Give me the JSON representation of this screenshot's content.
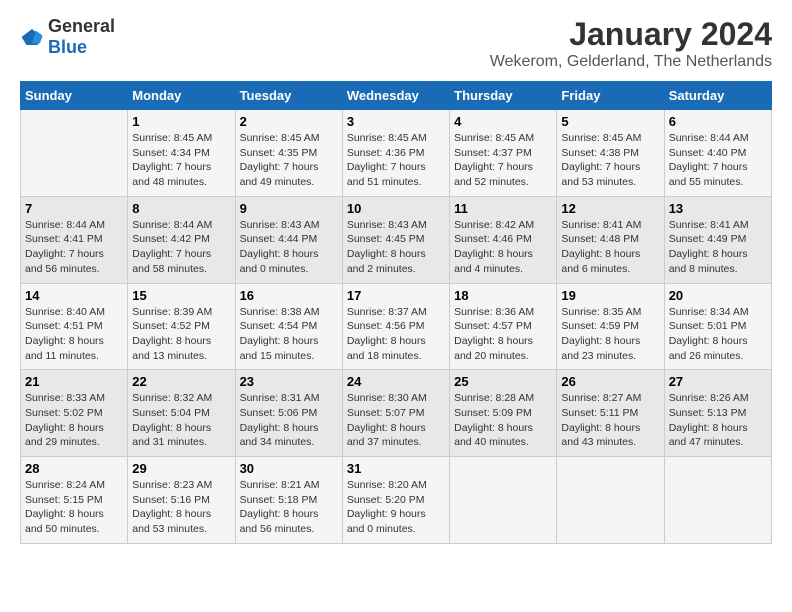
{
  "logo": {
    "general": "General",
    "blue": "Blue"
  },
  "title": "January 2024",
  "subtitle": "Wekerom, Gelderland, The Netherlands",
  "days_of_week": [
    "Sunday",
    "Monday",
    "Tuesday",
    "Wednesday",
    "Thursday",
    "Friday",
    "Saturday"
  ],
  "weeks": [
    [
      {
        "day": "",
        "content": ""
      },
      {
        "day": "1",
        "content": "Sunrise: 8:45 AM\nSunset: 4:34 PM\nDaylight: 7 hours\nand 48 minutes."
      },
      {
        "day": "2",
        "content": "Sunrise: 8:45 AM\nSunset: 4:35 PM\nDaylight: 7 hours\nand 49 minutes."
      },
      {
        "day": "3",
        "content": "Sunrise: 8:45 AM\nSunset: 4:36 PM\nDaylight: 7 hours\nand 51 minutes."
      },
      {
        "day": "4",
        "content": "Sunrise: 8:45 AM\nSunset: 4:37 PM\nDaylight: 7 hours\nand 52 minutes."
      },
      {
        "day": "5",
        "content": "Sunrise: 8:45 AM\nSunset: 4:38 PM\nDaylight: 7 hours\nand 53 minutes."
      },
      {
        "day": "6",
        "content": "Sunrise: 8:44 AM\nSunset: 4:40 PM\nDaylight: 7 hours\nand 55 minutes."
      }
    ],
    [
      {
        "day": "7",
        "content": "Sunrise: 8:44 AM\nSunset: 4:41 PM\nDaylight: 7 hours\nand 56 minutes."
      },
      {
        "day": "8",
        "content": "Sunrise: 8:44 AM\nSunset: 4:42 PM\nDaylight: 7 hours\nand 58 minutes."
      },
      {
        "day": "9",
        "content": "Sunrise: 8:43 AM\nSunset: 4:44 PM\nDaylight: 8 hours\nand 0 minutes."
      },
      {
        "day": "10",
        "content": "Sunrise: 8:43 AM\nSunset: 4:45 PM\nDaylight: 8 hours\nand 2 minutes."
      },
      {
        "day": "11",
        "content": "Sunrise: 8:42 AM\nSunset: 4:46 PM\nDaylight: 8 hours\nand 4 minutes."
      },
      {
        "day": "12",
        "content": "Sunrise: 8:41 AM\nSunset: 4:48 PM\nDaylight: 8 hours\nand 6 minutes."
      },
      {
        "day": "13",
        "content": "Sunrise: 8:41 AM\nSunset: 4:49 PM\nDaylight: 8 hours\nand 8 minutes."
      }
    ],
    [
      {
        "day": "14",
        "content": "Sunrise: 8:40 AM\nSunset: 4:51 PM\nDaylight: 8 hours\nand 11 minutes."
      },
      {
        "day": "15",
        "content": "Sunrise: 8:39 AM\nSunset: 4:52 PM\nDaylight: 8 hours\nand 13 minutes."
      },
      {
        "day": "16",
        "content": "Sunrise: 8:38 AM\nSunset: 4:54 PM\nDaylight: 8 hours\nand 15 minutes."
      },
      {
        "day": "17",
        "content": "Sunrise: 8:37 AM\nSunset: 4:56 PM\nDaylight: 8 hours\nand 18 minutes."
      },
      {
        "day": "18",
        "content": "Sunrise: 8:36 AM\nSunset: 4:57 PM\nDaylight: 8 hours\nand 20 minutes."
      },
      {
        "day": "19",
        "content": "Sunrise: 8:35 AM\nSunset: 4:59 PM\nDaylight: 8 hours\nand 23 minutes."
      },
      {
        "day": "20",
        "content": "Sunrise: 8:34 AM\nSunset: 5:01 PM\nDaylight: 8 hours\nand 26 minutes."
      }
    ],
    [
      {
        "day": "21",
        "content": "Sunrise: 8:33 AM\nSunset: 5:02 PM\nDaylight: 8 hours\nand 29 minutes."
      },
      {
        "day": "22",
        "content": "Sunrise: 8:32 AM\nSunset: 5:04 PM\nDaylight: 8 hours\nand 31 minutes."
      },
      {
        "day": "23",
        "content": "Sunrise: 8:31 AM\nSunset: 5:06 PM\nDaylight: 8 hours\nand 34 minutes."
      },
      {
        "day": "24",
        "content": "Sunrise: 8:30 AM\nSunset: 5:07 PM\nDaylight: 8 hours\nand 37 minutes."
      },
      {
        "day": "25",
        "content": "Sunrise: 8:28 AM\nSunset: 5:09 PM\nDaylight: 8 hours\nand 40 minutes."
      },
      {
        "day": "26",
        "content": "Sunrise: 8:27 AM\nSunset: 5:11 PM\nDaylight: 8 hours\nand 43 minutes."
      },
      {
        "day": "27",
        "content": "Sunrise: 8:26 AM\nSunset: 5:13 PM\nDaylight: 8 hours\nand 47 minutes."
      }
    ],
    [
      {
        "day": "28",
        "content": "Sunrise: 8:24 AM\nSunset: 5:15 PM\nDaylight: 8 hours\nand 50 minutes."
      },
      {
        "day": "29",
        "content": "Sunrise: 8:23 AM\nSunset: 5:16 PM\nDaylight: 8 hours\nand 53 minutes."
      },
      {
        "day": "30",
        "content": "Sunrise: 8:21 AM\nSunset: 5:18 PM\nDaylight: 8 hours\nand 56 minutes."
      },
      {
        "day": "31",
        "content": "Sunrise: 8:20 AM\nSunset: 5:20 PM\nDaylight: 9 hours\nand 0 minutes."
      },
      {
        "day": "",
        "content": ""
      },
      {
        "day": "",
        "content": ""
      },
      {
        "day": "",
        "content": ""
      }
    ]
  ]
}
